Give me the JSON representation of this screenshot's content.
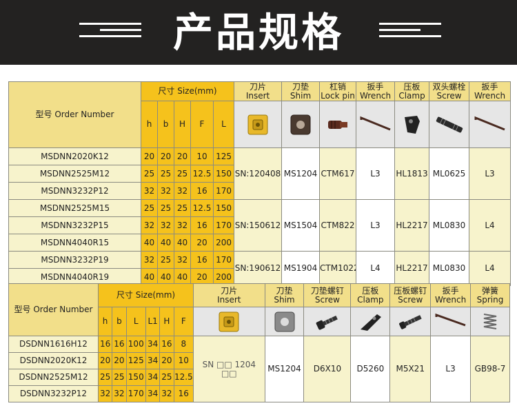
{
  "header": {
    "title": "产品规格"
  },
  "table1": {
    "model_header": "型号 Order Number",
    "size_header": "尺寸 Size(mm)",
    "dims": [
      "h",
      "b",
      "H",
      "F",
      "L"
    ],
    "parts": [
      {
        "cn": "刀片",
        "en": "Insert",
        "icon": "insert-icon"
      },
      {
        "cn": "刀垫",
        "en": "Shim",
        "icon": "shim-icon"
      },
      {
        "cn": "杠销",
        "en": "Lock pin",
        "icon": "lock-pin-icon"
      },
      {
        "cn": "扳手",
        "en": "Wrench",
        "icon": "wrench-icon"
      },
      {
        "cn": "压板",
        "en": "Clamp",
        "icon": "clamp-icon"
      },
      {
        "cn": "双头螺栓",
        "en": "Screw",
        "icon": "screw-icon"
      },
      {
        "cn": "扳手",
        "en": "Wrench",
        "icon": "wrench-icon"
      }
    ],
    "rows": [
      {
        "model": "MSDNN2020K12",
        "dims": [
          "20",
          "20",
          "20",
          "10",
          "125"
        ]
      },
      {
        "model": "MSDNN2525M12",
        "dims": [
          "25",
          "25",
          "25",
          "12.5",
          "150"
        ]
      },
      {
        "model": "MSDNN3232P12",
        "dims": [
          "32",
          "32",
          "32",
          "16",
          "170"
        ]
      },
      {
        "model": "MSDNN2525M15",
        "dims": [
          "25",
          "25",
          "25",
          "12.5",
          "150"
        ]
      },
      {
        "model": "MSDNN3232P15",
        "dims": [
          "32",
          "32",
          "32",
          "16",
          "170"
        ]
      },
      {
        "model": "MSDNN4040R15",
        "dims": [
          "40",
          "40",
          "40",
          "20",
          "200"
        ]
      },
      {
        "model": "MSDNN3232P19",
        "dims": [
          "32",
          "25",
          "32",
          "16",
          "170"
        ]
      },
      {
        "model": "MSDNN4040R19",
        "dims": [
          "40",
          "40",
          "40",
          "20",
          "200"
        ]
      }
    ],
    "groups": [
      {
        "insert": "SN:120408",
        "shim": "MS1204",
        "pin": "CTM617",
        "wrench": "L3",
        "clamp": "HL1813",
        "screw": "ML0625",
        "wrench2": "L3"
      },
      {
        "insert": "SN:150612",
        "shim": "MS1504",
        "pin": "CTM822",
        "wrench": "L3",
        "clamp": "HL2217",
        "screw": "ML0830",
        "wrench2": "L4"
      },
      {
        "insert": "SN:190612",
        "shim": "MS1904",
        "pin": "CTM1022",
        "wrench": "L4",
        "clamp": "HL2217",
        "screw": "ML0830",
        "wrench2": "L4"
      }
    ]
  },
  "table2": {
    "model_header": "型号 Order Number",
    "size_header": "尺寸 Size(mm)",
    "dims": [
      "h",
      "b",
      "L",
      "L1",
      "H",
      "F"
    ],
    "parts": [
      {
        "cn": "刀片",
        "en": "Insert",
        "icon": "insert-icon"
      },
      {
        "cn": "刀垫",
        "en": "Shim",
        "icon": "shim-icon"
      },
      {
        "cn": "刀垫螺钉",
        "en": "Screw",
        "icon": "screw-icon"
      },
      {
        "cn": "压板",
        "en": "Clamp",
        "icon": "clamp-icon"
      },
      {
        "cn": "压板螺钉",
        "en": "Screw",
        "icon": "screw-icon"
      },
      {
        "cn": "扳手",
        "en": "Wrench",
        "icon": "wrench-icon"
      },
      {
        "cn": "弹簧",
        "en": "Spring",
        "icon": "spring-icon"
      }
    ],
    "rows": [
      {
        "model": "DSDNN1616H12",
        "dims": [
          "16",
          "16",
          "100",
          "34",
          "16",
          "8"
        ]
      },
      {
        "model": "DSDNN2020K12",
        "dims": [
          "20",
          "20",
          "125",
          "34",
          "20",
          "10"
        ]
      },
      {
        "model": "DSDNN2525M12",
        "dims": [
          "25",
          "25",
          "150",
          "34",
          "25",
          "12.5"
        ]
      },
      {
        "model": "DSDNN3232P12",
        "dims": [
          "32",
          "32",
          "170",
          "34",
          "32",
          "16"
        ]
      }
    ],
    "group": {
      "insert": "SN □□ 1204 □□",
      "shim": "MS1204",
      "shim_screw": "D6X10",
      "clamp": "D5260",
      "clamp_screw": "M5X21",
      "wrench": "L3",
      "spring": "GB98-7"
    }
  },
  "colors": {
    "header_bg": "#232221",
    "yellow": "#f5c21c",
    "light_yellow": "#f2df8a",
    "cream": "#f7f3cc",
    "gray": "#e6e6e6"
  }
}
